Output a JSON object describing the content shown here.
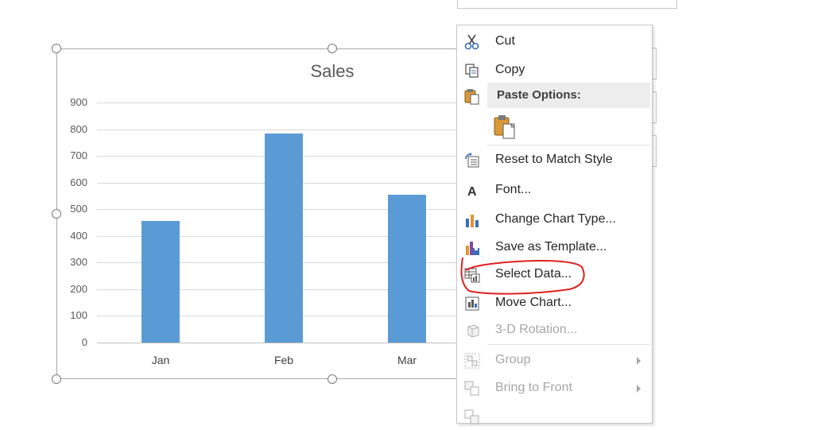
{
  "chart": {
    "title": "Sales"
  },
  "chart_data": {
    "type": "bar",
    "title": "Sales",
    "categories": [
      "Jan",
      "Feb",
      "Mar"
    ],
    "values": [
      455,
      785,
      555
    ],
    "ylim": [
      0,
      900
    ],
    "yticks": [
      "0",
      "100",
      "200",
      "300",
      "400",
      "500",
      "600",
      "700",
      "800",
      "900"
    ],
    "grid": true,
    "color": "#5b9bd5"
  },
  "context_menu": {
    "items": [
      {
        "label": "Cut",
        "icon": "scissors-icon",
        "enabled": true
      },
      {
        "label": "Copy",
        "icon": "copy-icon",
        "enabled": true
      },
      {
        "label": "Paste Options:",
        "icon": "paste-icon",
        "enabled": true,
        "header": true
      },
      {
        "label": "Reset to Match Style",
        "icon": "reset-style-icon",
        "enabled": true
      },
      {
        "label": "Font...",
        "icon": "font-icon",
        "enabled": true
      },
      {
        "label": "Change Chart Type...",
        "icon": "chart-type-icon",
        "enabled": true
      },
      {
        "label": "Save as Template...",
        "icon": "save-template-icon",
        "enabled": true
      },
      {
        "label": "Select Data...",
        "icon": "select-data-icon",
        "enabled": true
      },
      {
        "label": "Move Chart...",
        "icon": "move-chart-icon",
        "enabled": true
      },
      {
        "label": "3-D Rotation...",
        "icon": "rotation-icon",
        "enabled": false
      },
      {
        "label": "Group",
        "icon": "group-icon",
        "enabled": false,
        "submenu": true
      },
      {
        "label": "Bring to Front",
        "icon": "bring-front-icon",
        "enabled": false,
        "submenu": true
      }
    ]
  },
  "annotation": {
    "color": "#e02020",
    "target": "Select Data..."
  }
}
